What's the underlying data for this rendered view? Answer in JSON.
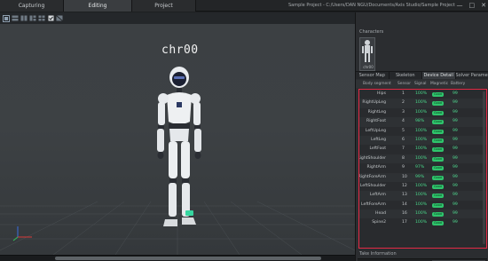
{
  "tabs": [
    {
      "label": "Capturing"
    },
    {
      "label": "Editing"
    },
    {
      "label": "Project"
    }
  ],
  "title": "Sample Project - C:/Users/DAN NGU/Documents/Axis Studio/Sample Project",
  "window_controls": {
    "minimize": "—",
    "maximize": "□",
    "close": "✕"
  },
  "viewport": {
    "character_label": "chr00"
  },
  "characters_panel": {
    "title": "Characters",
    "card_label": "chr00"
  },
  "panel_tabs": [
    {
      "label": "Sensor Map"
    },
    {
      "label": "Skeleton"
    },
    {
      "label": "Device Detail"
    },
    {
      "label": "Solver Parameter"
    }
  ],
  "device_table": {
    "headers": {
      "body_segment": "Body segment",
      "sensor": "Sensor",
      "signal": "Signal",
      "magnetic": "Magnetic",
      "battery": "Battery"
    },
    "rows": [
      {
        "segment": "Hips",
        "sensor": "1",
        "signal": "100%",
        "magnetic": "Good",
        "battery": "99"
      },
      {
        "segment": "RightUpLeg",
        "sensor": "2",
        "signal": "100%",
        "magnetic": "Good",
        "battery": "99"
      },
      {
        "segment": "RightLeg",
        "sensor": "3",
        "signal": "100%",
        "magnetic": "Good",
        "battery": "99"
      },
      {
        "segment": "RightFoot",
        "sensor": "4",
        "signal": "98%",
        "magnetic": "Good",
        "battery": "99"
      },
      {
        "segment": "LeftUpLeg",
        "sensor": "5",
        "signal": "100%",
        "magnetic": "Good",
        "battery": "99"
      },
      {
        "segment": "LeftLeg",
        "sensor": "6",
        "signal": "100%",
        "magnetic": "Good",
        "battery": "99"
      },
      {
        "segment": "LeftFoot",
        "sensor": "7",
        "signal": "100%",
        "magnetic": "Good",
        "battery": "99"
      },
      {
        "segment": "RightShoulder",
        "sensor": "8",
        "signal": "100%",
        "magnetic": "Good",
        "battery": "99"
      },
      {
        "segment": "RightArm",
        "sensor": "9",
        "signal": "97%",
        "magnetic": "Good",
        "battery": "99"
      },
      {
        "segment": "RightForeArm",
        "sensor": "10",
        "signal": "99%",
        "magnetic": "Good",
        "battery": "99"
      },
      {
        "segment": "LeftShoulder",
        "sensor": "12",
        "signal": "100%",
        "magnetic": "Good",
        "battery": "99"
      },
      {
        "segment": "LeftArm",
        "sensor": "13",
        "signal": "100%",
        "magnetic": "Good",
        "battery": "99"
      },
      {
        "segment": "LeftForeArm",
        "sensor": "14",
        "signal": "100%",
        "magnetic": "Good",
        "battery": "99"
      },
      {
        "segment": "Head",
        "sensor": "16",
        "signal": "100%",
        "magnetic": "Good",
        "battery": "99"
      },
      {
        "segment": "Spine2",
        "sensor": "17",
        "signal": "100%",
        "magnetic": "Good",
        "battery": "99"
      }
    ]
  },
  "take_info": {
    "title": "Take Information"
  },
  "colors": {
    "highlight_border": "#e52a45",
    "status_green": "#2fc46c",
    "accent_blue": "#3d79d6"
  }
}
